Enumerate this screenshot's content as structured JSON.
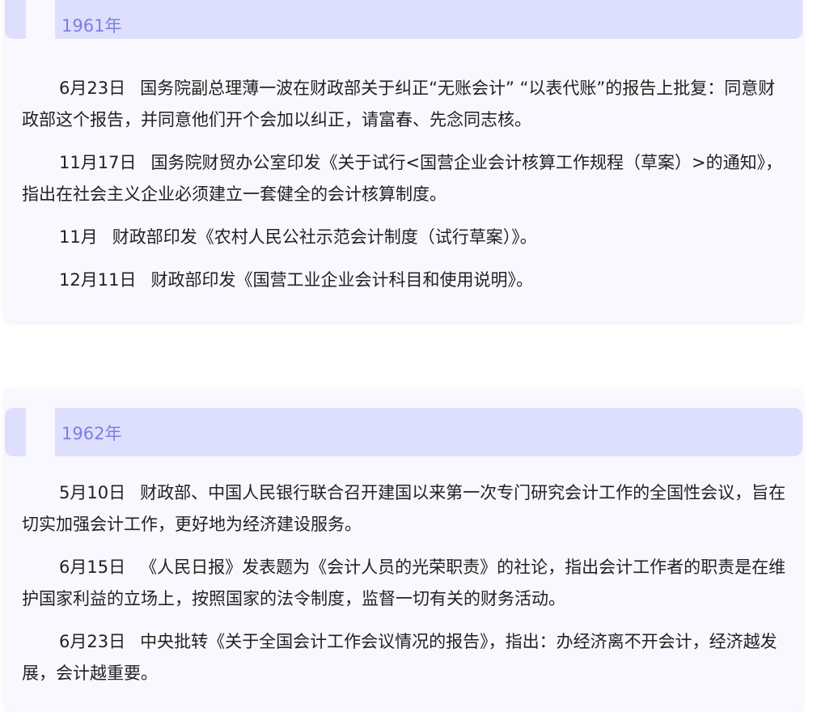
{
  "sections": [
    {
      "year": "1961年",
      "entries": [
        {
          "date": "6月23日",
          "text": "国务院副总理薄一波在财政部关于纠正“无账会计” “以表代账”的报告上批复：同意财政部这个报告，并同意他们开个会加以纠正，请富春、先念同志核。"
        },
        {
          "date": "11月17日",
          "text": "国务院财贸办公室印发《关于试行<国营企业会计核算工作规程（草案）>的通知》，指出在社会主义企业必须建立一套健全的会计核算制度。"
        },
        {
          "date": "11月",
          "text": "财政部印发《农村人民公社示范会计制度（试行草案）》。"
        },
        {
          "date": "12月11日",
          "text": "财政部印发《国营工业企业会计科目和使用说明》。"
        }
      ]
    },
    {
      "year": "1962年",
      "entries": [
        {
          "date": "5月10日",
          "text": "财政部、中国人民银行联合召开建国以来第一次专门研究会计工作的全国性会议，旨在切实加强会计工作，更好地为经济建设服务。"
        },
        {
          "date": "6月15日",
          "text": "《人民日报》发表题为《会计人员的光荣职责》的社论，指出会计工作者的职责是在维护国家利益的立场上，按照国家的法令制度，监督一切有关的财务活动。"
        },
        {
          "date": "6月23日",
          "text": "中央批转《关于全国会计工作会议情况的报告》，指出：办经济离不开会计，经济越发展，会计越重要。"
        }
      ]
    }
  ]
}
